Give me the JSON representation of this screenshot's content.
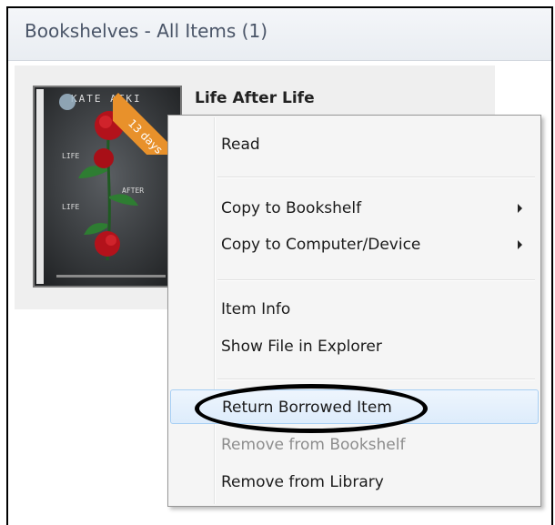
{
  "window": {
    "title": "Bookshelves - All Items (1)"
  },
  "item": {
    "title": "Life After Life",
    "badge": "13 days"
  },
  "context_menu": {
    "items": [
      {
        "label": "Read",
        "submenu": false,
        "disabled": false
      },
      {
        "label": "Copy to Bookshelf",
        "submenu": true,
        "disabled": false
      },
      {
        "label": "Copy to Computer/Device",
        "submenu": true,
        "disabled": false
      },
      {
        "label": "Item Info",
        "submenu": false,
        "disabled": false
      },
      {
        "label": "Show File in Explorer",
        "submenu": false,
        "disabled": false
      },
      {
        "label": "Return Borrowed Item",
        "submenu": false,
        "disabled": false,
        "highlighted": true
      },
      {
        "label": "Remove from Bookshelf",
        "submenu": false,
        "disabled": true
      },
      {
        "label": "Remove from Library",
        "submenu": false,
        "disabled": false
      }
    ]
  },
  "colors": {
    "badge": "#e8912b",
    "hover_fill": "#ddecfb",
    "hover_border": "#a8cff4",
    "annotation_circle": "#000000"
  }
}
